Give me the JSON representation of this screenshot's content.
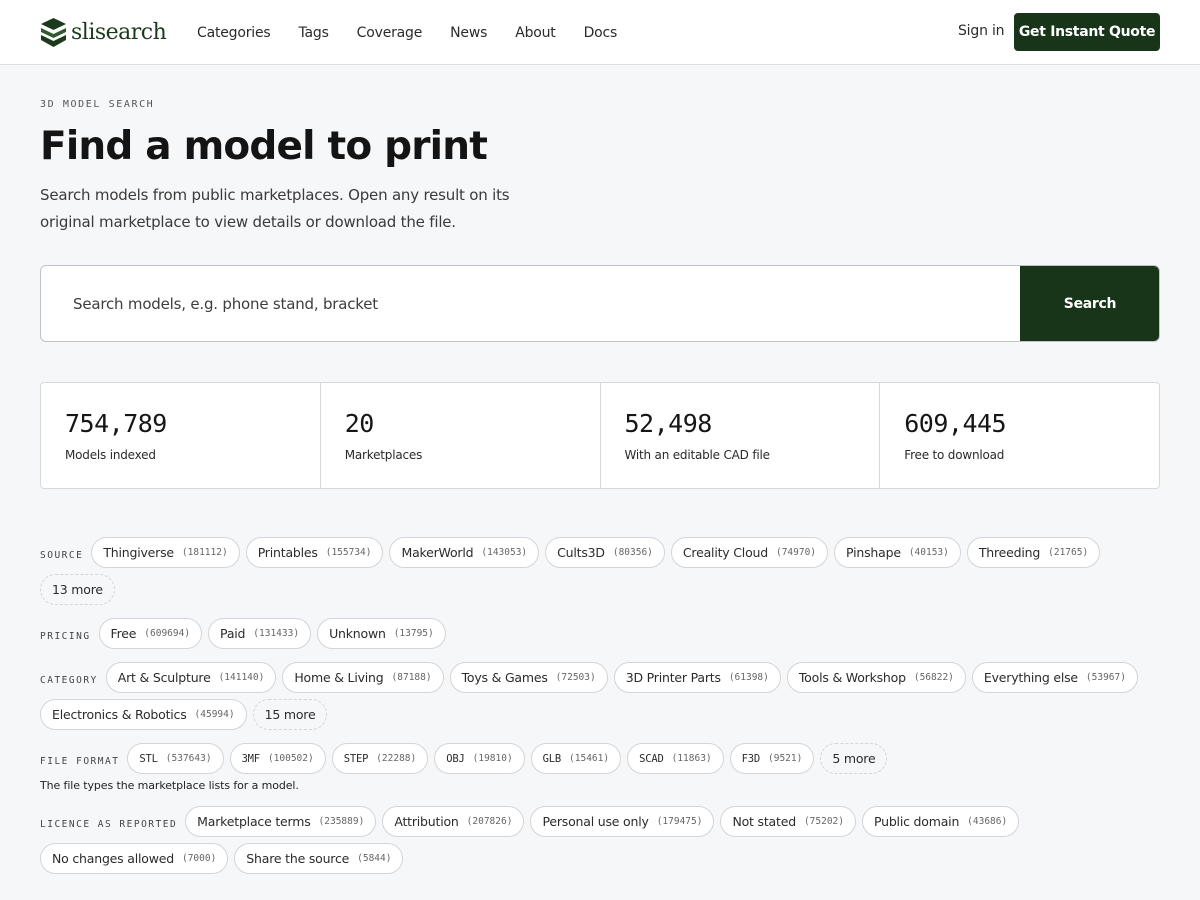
{
  "header": {
    "logo_text": "slisearch",
    "nav": [
      "Categories",
      "Tags",
      "Coverage",
      "News",
      "About",
      "Docs"
    ],
    "signin": "Sign in",
    "cta": "Get Instant Quote"
  },
  "hero": {
    "eyebrow": "3D MODEL SEARCH",
    "title": "Find a model to print",
    "subtitle": "Search models from public marketplaces. Open any result on its original marketplace to view details or download the file."
  },
  "search": {
    "placeholder": "Search models, e.g. phone stand, bracket",
    "button": "Search"
  },
  "stats": [
    {
      "value": "754,789",
      "label": "Models indexed"
    },
    {
      "value": "20",
      "label": "Marketplaces"
    },
    {
      "value": "52,498",
      "label": "With an editable CAD file"
    },
    {
      "value": "609,445",
      "label": "Free to download"
    }
  ],
  "filters": {
    "source": {
      "label": "SOURCE",
      "chips": [
        {
          "name": "Thingiverse",
          "count": "(181112)"
        },
        {
          "name": "Printables",
          "count": "(155734)"
        },
        {
          "name": "MakerWorld",
          "count": "(143053)"
        },
        {
          "name": "Cults3D",
          "count": "(80356)"
        },
        {
          "name": "Creality Cloud",
          "count": "(74970)"
        },
        {
          "name": "Pinshape",
          "count": "(40153)"
        },
        {
          "name": "Threeding",
          "count": "(21765)"
        }
      ],
      "more": "13 more"
    },
    "pricing": {
      "label": "PRICING",
      "chips": [
        {
          "name": "Free",
          "count": "(609694)"
        },
        {
          "name": "Paid",
          "count": "(131433)"
        },
        {
          "name": "Unknown",
          "count": "(13795)"
        }
      ]
    },
    "category": {
      "label": "CATEGORY",
      "chips": [
        {
          "name": "Art & Sculpture",
          "count": "(141140)"
        },
        {
          "name": "Home & Living",
          "count": "(87188)"
        },
        {
          "name": "Toys & Games",
          "count": "(72503)"
        },
        {
          "name": "3D Printer Parts",
          "count": "(61398)"
        },
        {
          "name": "Tools & Workshop",
          "count": "(56822)"
        },
        {
          "name": "Everything else",
          "count": "(53967)"
        },
        {
          "name": "Electronics & Robotics",
          "count": "(45994)"
        }
      ],
      "more": "15 more"
    },
    "file_format": {
      "label": "FILE FORMAT",
      "chips": [
        {
          "name": "STL",
          "count": "(537643)"
        },
        {
          "name": "3MF",
          "count": "(100502)"
        },
        {
          "name": "STEP",
          "count": "(22288)"
        },
        {
          "name": "OBJ",
          "count": "(19810)"
        },
        {
          "name": "GLB",
          "count": "(15461)"
        },
        {
          "name": "SCAD",
          "count": "(11863)"
        },
        {
          "name": "F3D",
          "count": "(9521)"
        }
      ],
      "more": "5 more",
      "note": "The file types the marketplace lists for a model."
    },
    "licence": {
      "label": "LICENCE AS REPORTED",
      "chips": [
        {
          "name": "Marketplace terms",
          "count": "(235889)"
        },
        {
          "name": "Attribution",
          "count": "(207826)"
        },
        {
          "name": "Personal use only",
          "count": "(179475)"
        },
        {
          "name": "Not stated",
          "count": "(75202)"
        },
        {
          "name": "Public domain",
          "count": "(43686)"
        },
        {
          "name": "No changes allowed",
          "count": "(7000)"
        },
        {
          "name": "Share the source",
          "count": "(5844)"
        }
      ]
    }
  }
}
